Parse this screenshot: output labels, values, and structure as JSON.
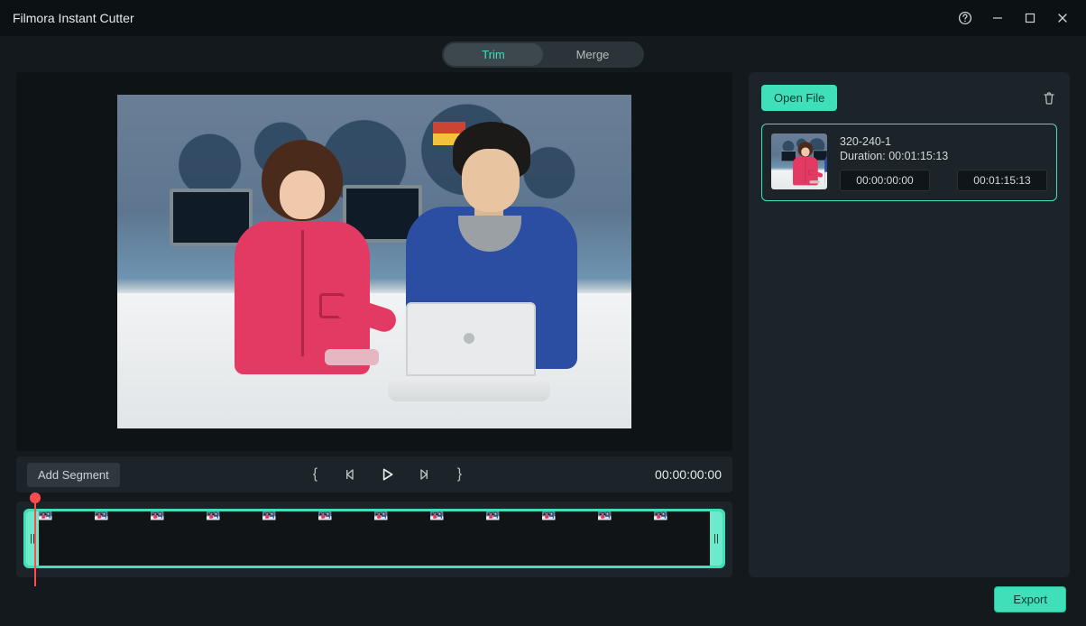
{
  "titlebar": {
    "title": "Filmora Instant Cutter"
  },
  "tabs": {
    "trim": "Trim",
    "merge": "Merge",
    "active": "trim"
  },
  "controls": {
    "add_segment": "Add Segment",
    "timecode": "00:00:00:00"
  },
  "sidebar": {
    "open_file": "Open File",
    "clip": {
      "name": "320-240-1",
      "duration_label": "Duration:",
      "duration": "00:01:15:13",
      "in": "00:00:00:00",
      "out": "00:01:15:13"
    }
  },
  "footer": {
    "export": "Export"
  },
  "colors": {
    "accent": "#3fe0b9"
  }
}
